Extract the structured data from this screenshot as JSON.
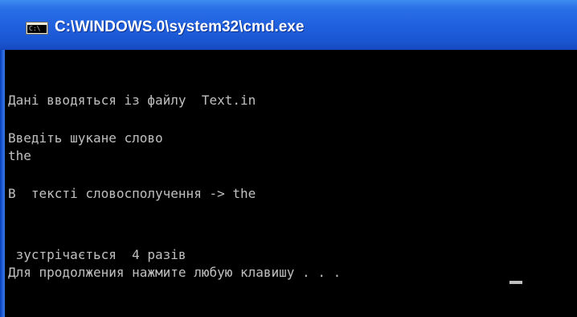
{
  "window": {
    "title": "C:\\WINDOWS.0\\system32\\cmd.exe",
    "icon_glyph": "C:\\"
  },
  "console": {
    "lines": [
      "Дані вводяться із файлу  Text.in",
      "Введіть шукане слово",
      "the",
      "В  тексті словосполучення -> the",
      " зустрічається  4 разів",
      "Для продолжения нажмите любую клавишу . . . "
    ]
  },
  "colors": {
    "title_bar": "#1f5fde",
    "title_text": "#ffffff",
    "console_bg": "#000000",
    "console_text": "#c0c0c0"
  },
  "icons": {
    "title": "console-app-icon",
    "cursor": "text-cursor"
  }
}
